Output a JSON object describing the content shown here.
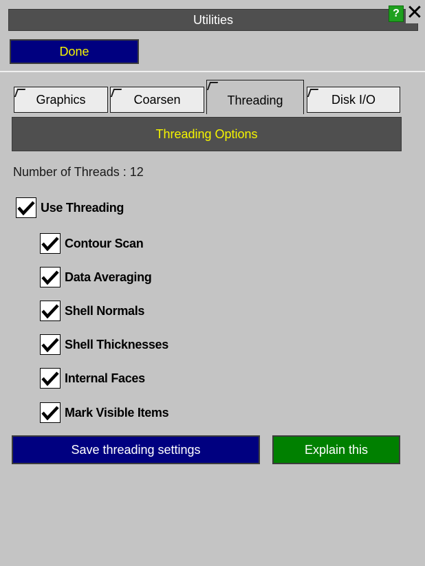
{
  "window": {
    "title": "Utilities",
    "help_label": "?",
    "close_label": "✕"
  },
  "done_label": "Done",
  "tabs": [
    {
      "label": "Graphics",
      "active": false
    },
    {
      "label": "Coarsen",
      "active": false
    },
    {
      "label": "Threading",
      "active": true
    },
    {
      "label": "Disk I/O",
      "active": false
    }
  ],
  "section": {
    "title": "Threading Options",
    "threads_text": "Number of Threads : 12"
  },
  "checkboxes": {
    "use_threading": {
      "label": "Use Threading",
      "checked": true
    },
    "contour_scan": {
      "label": "Contour Scan",
      "checked": true
    },
    "data_averaging": {
      "label": "Data Averaging",
      "checked": true
    },
    "shell_normals": {
      "label": "Shell Normals",
      "checked": true
    },
    "shell_thicknesses": {
      "label": "Shell Thicknesses",
      "checked": true
    },
    "internal_faces": {
      "label": "Internal Faces",
      "checked": true
    },
    "mark_visible_items": {
      "label": "Mark Visible Items",
      "checked": true
    }
  },
  "buttons": {
    "save_label": "Save threading settings",
    "explain_label": "Explain this"
  },
  "colors": {
    "background": "#c4c4c4",
    "header_bar": "#4f4f4f",
    "header_text": "#f5f500",
    "primary_button": "#000080",
    "help_button": "#1fa01f",
    "explain_button": "#008000"
  }
}
